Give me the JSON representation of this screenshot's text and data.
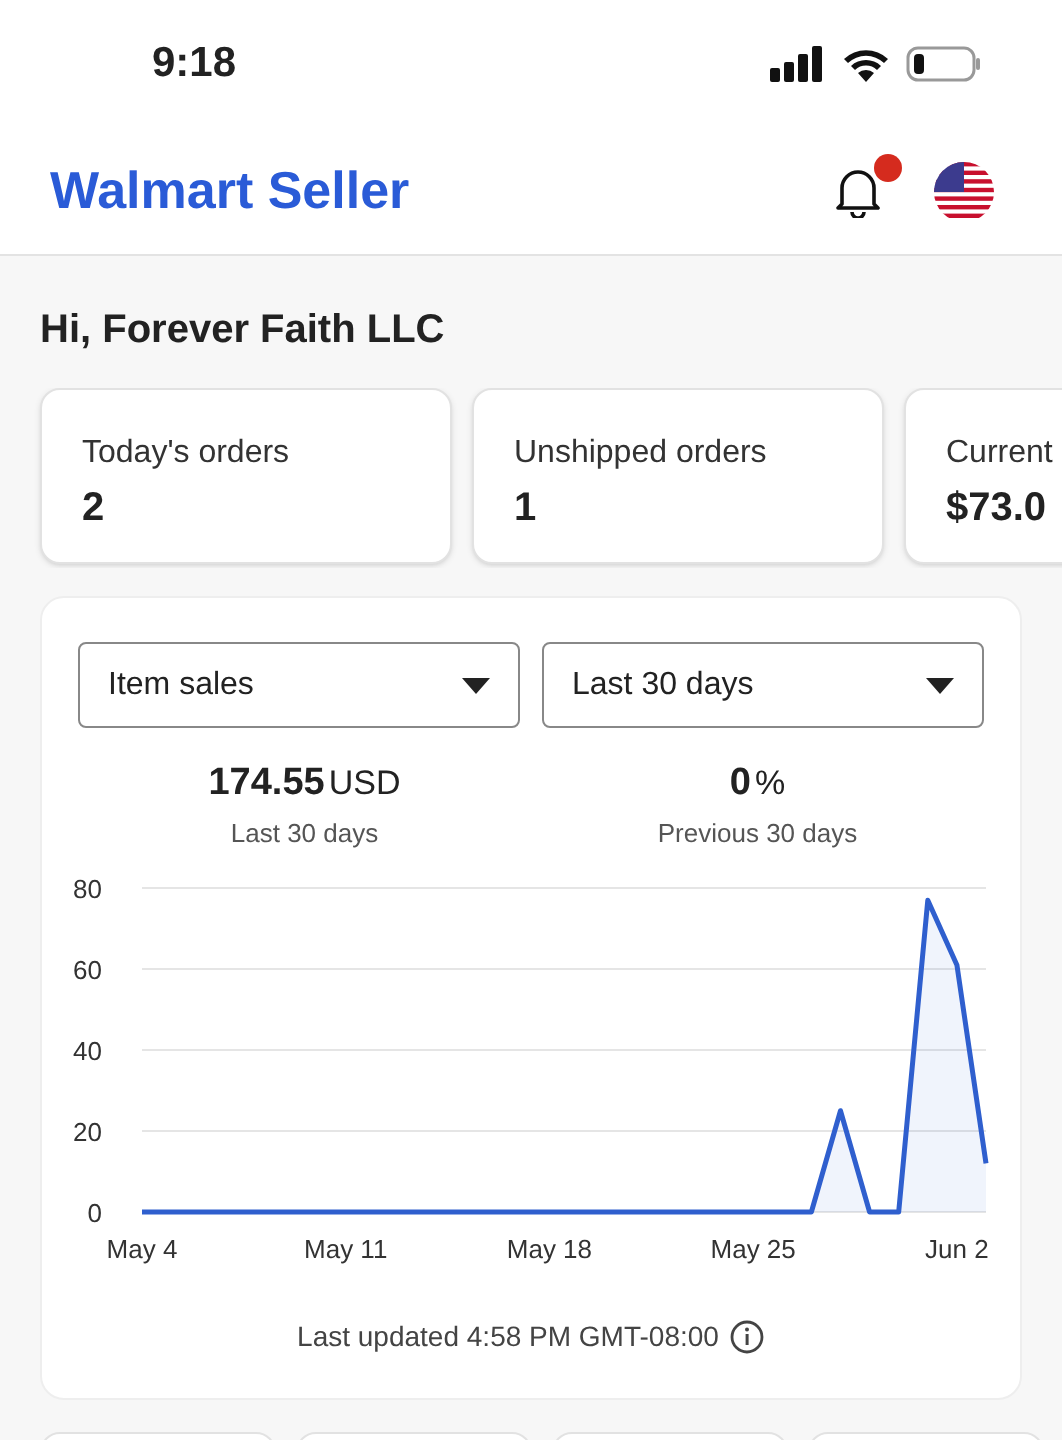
{
  "status_bar": {
    "time": "9:18"
  },
  "header": {
    "title": "Walmart Seller",
    "notification_dot": true
  },
  "greeting": "Hi, Forever Faith LLC",
  "summary_cards": [
    {
      "label": "Today's orders",
      "value": "2"
    },
    {
      "label": "Unshipped orders",
      "value": "1"
    },
    {
      "label": "Current",
      "value": "$73.0"
    }
  ],
  "sales_card": {
    "dropdowns": [
      {
        "value": "Item sales"
      },
      {
        "value": "Last 30 days"
      }
    ],
    "stats": [
      {
        "value": "174.55",
        "unit": "USD",
        "caption": "Last 30 days"
      },
      {
        "value": "0",
        "unit": "%",
        "caption": "Previous 30 days"
      }
    ],
    "chart_data": {
      "type": "area",
      "categories": [
        "May 4",
        null,
        null,
        null,
        null,
        null,
        null,
        "May 11",
        null,
        null,
        null,
        null,
        null,
        null,
        "May 18",
        null,
        null,
        null,
        null,
        null,
        null,
        "May 25",
        null,
        null,
        null,
        null,
        null,
        null,
        "Jun 2",
        null
      ],
      "series": [
        {
          "color": "#2f5fce",
          "values": [
            0,
            0,
            0,
            0,
            0,
            0,
            0,
            0,
            0,
            0,
            0,
            0,
            0,
            0,
            0,
            0,
            0,
            0,
            0,
            0,
            0,
            0,
            0,
            0,
            25,
            0,
            0,
            77,
            61,
            12
          ]
        }
      ],
      "ylim": [
        0,
        80
      ],
      "yticks": [
        0,
        20,
        40,
        60,
        80
      ],
      "grid": true
    },
    "last_updated": "Last updated 4:58 PM GMT-08:00"
  }
}
